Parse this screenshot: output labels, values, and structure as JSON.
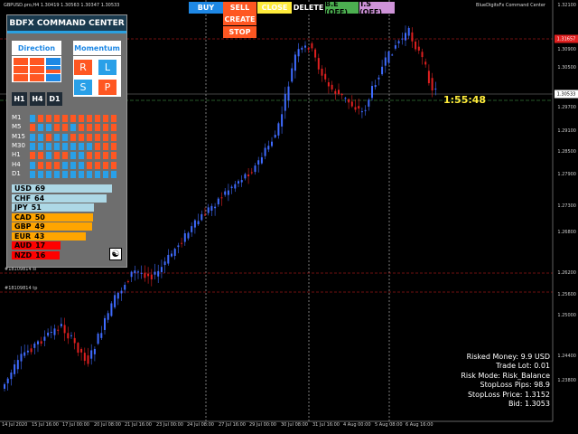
{
  "header": {
    "symbol_info": "GBPUSD.pro,H4  1.30419 1.30563 1.30347 1.30533",
    "indicator_name": "BlueDigitsFx Command Center"
  },
  "toolbar": {
    "buy_label": "BUY",
    "sell_label": "SELL",
    "close_label": "CLOSE",
    "delete_label": "DELETE",
    "be_label": "B.E (OFF)",
    "ts_label": "T.S (OFF)",
    "create_label": "CREATE",
    "stop_label": "STOP"
  },
  "colors": {
    "bull_candle": "#3f6bff",
    "bear_candle": "#e02020",
    "orange": "#ff5722",
    "blue": "#1e88e5",
    "light_blue": "#29a0e8"
  },
  "price_axis": {
    "labels": [
      "1.32100",
      "1.30900",
      "1.30500",
      "1.29700",
      "1.29100",
      "1.28500",
      "1.27900",
      "1.27300",
      "1.26800",
      "1.26200",
      "1.25600",
      "1.25000",
      "1.24400",
      "1.23800"
    ],
    "current_price_tag": "1.30533",
    "sell_level_tag": "1.31657"
  },
  "time_axis": {
    "labels": [
      "14 Jul 2020",
      "15 Jul 16:00",
      "17 Jul 00:00",
      "20 Jul 08:00",
      "21 Jul 16:00",
      "23 Jul 00:00",
      "24 Jul 08:00",
      "27 Jul 16:00",
      "29 Jul 00:00",
      "30 Jul 08:00",
      "31 Jul 16:00",
      "4 Aug 00:00",
      "5 Aug 08:00",
      "6 Aug 16:00"
    ]
  },
  "chart": {
    "countdown": "1:55:48",
    "hline_label": "#18109814 tp",
    "order_label": "#18109814 sl"
  },
  "panel": {
    "title": "BDFX COMMAND CENTER",
    "direction_label": "Direction",
    "momentum_label": "Momentum",
    "momentum_buttons": [
      {
        "letter": "R",
        "color": "#ff5722"
      },
      {
        "letter": "L",
        "color": "#29a0e8"
      },
      {
        "letter": "S",
        "color": "#29a0e8"
      },
      {
        "letter": "P",
        "color": "#ff5722"
      }
    ],
    "timeframe_buttons": [
      "H1",
      "H4",
      "D1"
    ],
    "timeframes": [
      {
        "label": "M1",
        "cells": "BOOOOOOOOOO"
      },
      {
        "label": "M5",
        "cells": "OBBOOBOOOOO"
      },
      {
        "label": "M15",
        "cells": "BBOBBOOOOOO"
      },
      {
        "label": "M30",
        "cells": "BBBBBBBBOOO"
      },
      {
        "label": "H1",
        "cells": "OOBOOBBOOOO"
      },
      {
        "label": "H4",
        "cells": "BOOOBBBOOOO"
      },
      {
        "label": "D1",
        "cells": "BBBBBBBBBBB"
      }
    ],
    "currencies": [
      {
        "name": "USD",
        "value": "69",
        "level": 0.69,
        "color": "#add8e6"
      },
      {
        "name": "CHF",
        "value": "64",
        "level": 0.64,
        "color": "#add8e6"
      },
      {
        "name": "JPY",
        "value": "51",
        "level": 0.51,
        "color": "#add8e6"
      },
      {
        "name": "CAD",
        "value": "50",
        "level": 0.5,
        "color": "#ffa500"
      },
      {
        "name": "GBP",
        "value": "49",
        "level": 0.49,
        "color": "#ffa500"
      },
      {
        "name": "EUR",
        "value": "43",
        "level": 0.43,
        "color": "#ffa500"
      },
      {
        "name": "AUD",
        "value": "17",
        "level": 0.17,
        "color": "#ff0000"
      },
      {
        "name": "NZD",
        "value": "16",
        "level": 0.16,
        "color": "#ff0000"
      }
    ],
    "icon_name": "yin-yang-icon"
  },
  "info": {
    "lines": [
      "Risked Money: 9.9 USD",
      "Trade Lot: 0.01",
      "Risk Mode: Risk_Balance",
      "StopLoss Pips: 98.9",
      "StopLoss Price: 1.3152",
      "Bid: 1.3053"
    ]
  }
}
